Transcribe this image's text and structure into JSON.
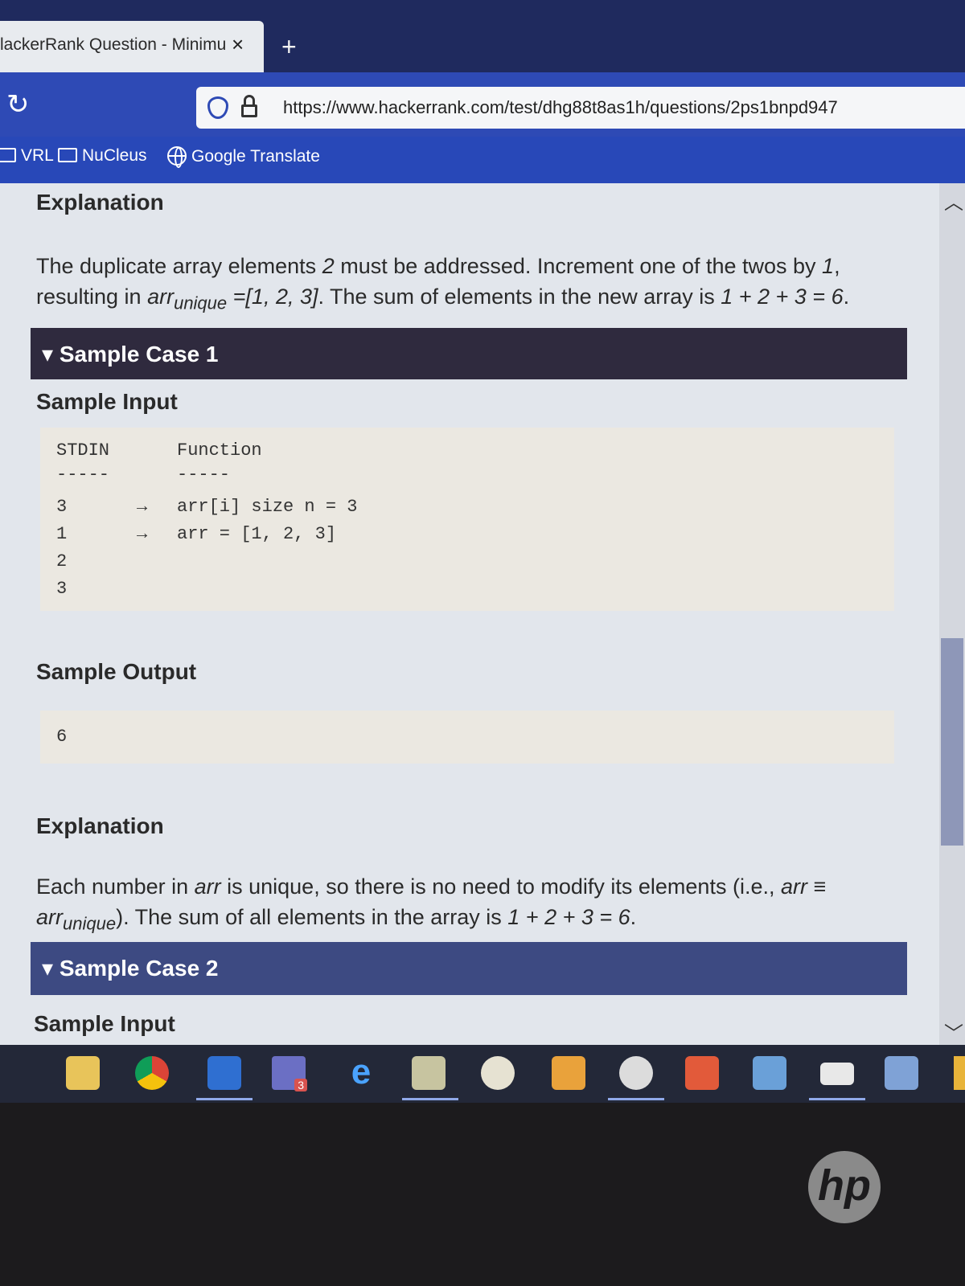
{
  "browser": {
    "tab_title": "lackerRank Question - Minimu",
    "tab_close": "×",
    "new_tab": "+",
    "url": "https://www.hackerrank.com/test/dhg88t8as1h/questions/2ps1bnpd947",
    "bookmarks": [
      "VRL",
      "NuCleus",
      "Google Translate"
    ]
  },
  "content": {
    "explanation0": {
      "heading": "Explanation",
      "text_a": "The duplicate array elements ",
      "text_b": "2",
      "text_c": " must be addressed. Increment one of the twos by ",
      "text_d": "1",
      "text_e": ",",
      "text_f": "resulting in ",
      "text_g": "arr",
      "text_h": "unique",
      "text_i": " =[1, 2, 3]",
      "text_j": ". The sum of elements in the new array is ",
      "text_k": "1 + 2 + 3 = 6",
      "text_l": "."
    },
    "case1": {
      "header": "▾ Sample Case 1",
      "input_heading": "Sample Input",
      "stdin_label": "STDIN",
      "function_label": "Function",
      "dashes": "-----",
      "lines": [
        {
          "stdin": "3",
          "arrow": "→",
          "func": "arr[i] size n = 3"
        },
        {
          "stdin": "1",
          "arrow": "→",
          "func": "arr = [1, 2, 3]"
        },
        {
          "stdin": "2",
          "arrow": "",
          "func": ""
        },
        {
          "stdin": "3",
          "arrow": "",
          "func": ""
        }
      ],
      "output_heading": "Sample Output",
      "output_value": "6",
      "explanation_heading": "Explanation",
      "expl_a": "Each number in ",
      "expl_b": "arr",
      "expl_c": " is unique, so there is no need to modify its elements (i.e., ",
      "expl_d": "arr ≡",
      "expl_e": "arr",
      "expl_f": "unique",
      "expl_g": "). The sum of all elements in the array is ",
      "expl_h": "1 + 2 + 3 = 6",
      "expl_i": "."
    },
    "case2": {
      "header": "▾ Sample Case 2",
      "input_heading": "Sample Input"
    }
  },
  "taskbar": {
    "icons": [
      "file-explorer-icon",
      "chrome-icon",
      "outlook-icon",
      "teams-icon",
      "internet-explorer-icon",
      "notepad-icon",
      "ue-icon",
      "mail-icon",
      "paint-icon",
      "app-icon",
      "network-icon",
      "terminal-icon",
      "connection-icon"
    ],
    "teams_badge": "3"
  },
  "colors": {
    "tabbar": "#1f2a5e",
    "navbar": "#2e4ab5",
    "case1_header": "#2f2a3e",
    "case2_header": "#3d4a82"
  },
  "bezel": {
    "logo": "hp"
  }
}
